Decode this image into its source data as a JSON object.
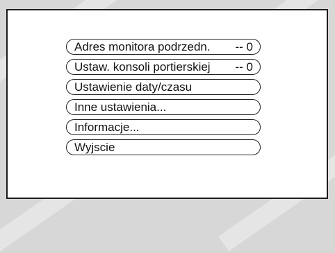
{
  "screen": {
    "background_color": "#ffffff",
    "border_color": "#1c1c1c",
    "page_background_color": "#d7d7d7"
  },
  "menu": {
    "items": [
      {
        "label": "Adres monitora podrzedn.",
        "value": "--  0"
      },
      {
        "label": "Ustaw. konsoli portierskiej",
        "value": "--  0"
      },
      {
        "label": "Ustawienie daty/czasu",
        "value": ""
      },
      {
        "label": "Inne ustawienia...",
        "value": ""
      },
      {
        "label": "Informacje...",
        "value": ""
      },
      {
        "label": "Wyjscie",
        "value": ""
      }
    ]
  }
}
